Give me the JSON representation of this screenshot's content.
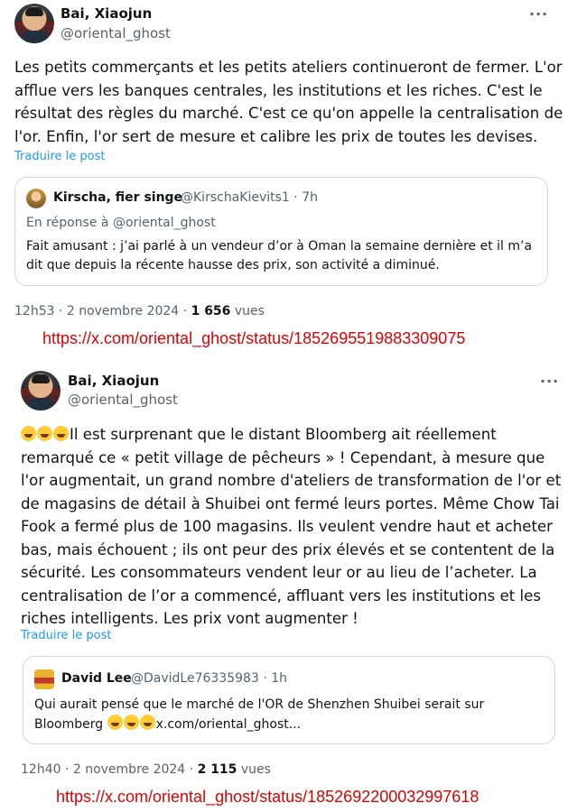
{
  "tweet1": {
    "author_name": "Bai, Xiaojun",
    "author_handle": "@oriental_ghost",
    "more_label": "···",
    "body": "Les petits commerçants et les petits ateliers continueront de fermer. L'or afflue vers les banques centrales, les institutions et les riches. C'est le résultat des règles du marché. C'est ce qu'on appelle la centralisation de l'or. Enfin, l'or sert de mesure et calibre les prix de toutes les devises.",
    "translate_label": "Traduire le post",
    "quote": {
      "author_name": "Kirscha, fier singe",
      "author_handle": "@KirschaKievits1",
      "separator": "·",
      "time": "7h",
      "reply_to": "En réponse à @oriental_ghost",
      "text": "Fait amusant : j’ai parlé à un vendeur d’or à Oman la semaine dernière et il m’a dit que depuis la récente hausse des prix, son activité a diminué."
    },
    "timestamp": "12h53 · 2 novembre 2024 ·",
    "views_count": "1 656",
    "views_label": "vues",
    "url": "https://x.com/oriental_ghost/status/1852695519883309075"
  },
  "tweet2": {
    "author_name": "Bai, Xiaojun",
    "author_handle": "@oriental_ghost",
    "more_label": "···",
    "body": "Il est surprenant que le distant Bloomberg ait réellement remarqué ce « petit village de pêcheurs » ! Cependant, à mesure que l'or augmentait, un grand nombre d'ateliers de transformation de l'or et de magasins de détail à Shuibei ont fermé leurs portes. Même Chow Tai Fook a fermé plus de 100 magasins. Ils veulent vendre haut et acheter bas, mais échouent ; ils ont peur des prix élevés et se contentent de la sécurité. Les consommateurs vendent leur or au lieu de l’acheter. La centralisation de l’or a commencé, affluant vers les institutions et les riches intelligents. Les prix vont augmenter !",
    "body_emoji": "rolling-on-floor-laughing",
    "translate_label": "Traduire le post",
    "quote": {
      "author_name": "David Lee",
      "author_handle": "@DavidLe76335983",
      "separator": "·",
      "time": "1h",
      "text_main": "Qui aurait pensé que le marché de l'OR de Shenzhen Shuibei serait sur Bloomberg",
      "text_link": "x.com/oriental_ghost...",
      "avatar_icon": "throne-icon"
    },
    "timestamp": "12h40 · 2 novembre 2024 ·",
    "views_count": "2 115",
    "views_label": "vues",
    "url": "https://x.com/oriental_ghost/status/1852692200032997618"
  },
  "colors": {
    "link": "#1d9bf0",
    "url_annotation": "#e00000",
    "secondary_text": "#536471",
    "border": "#cfd9de"
  }
}
